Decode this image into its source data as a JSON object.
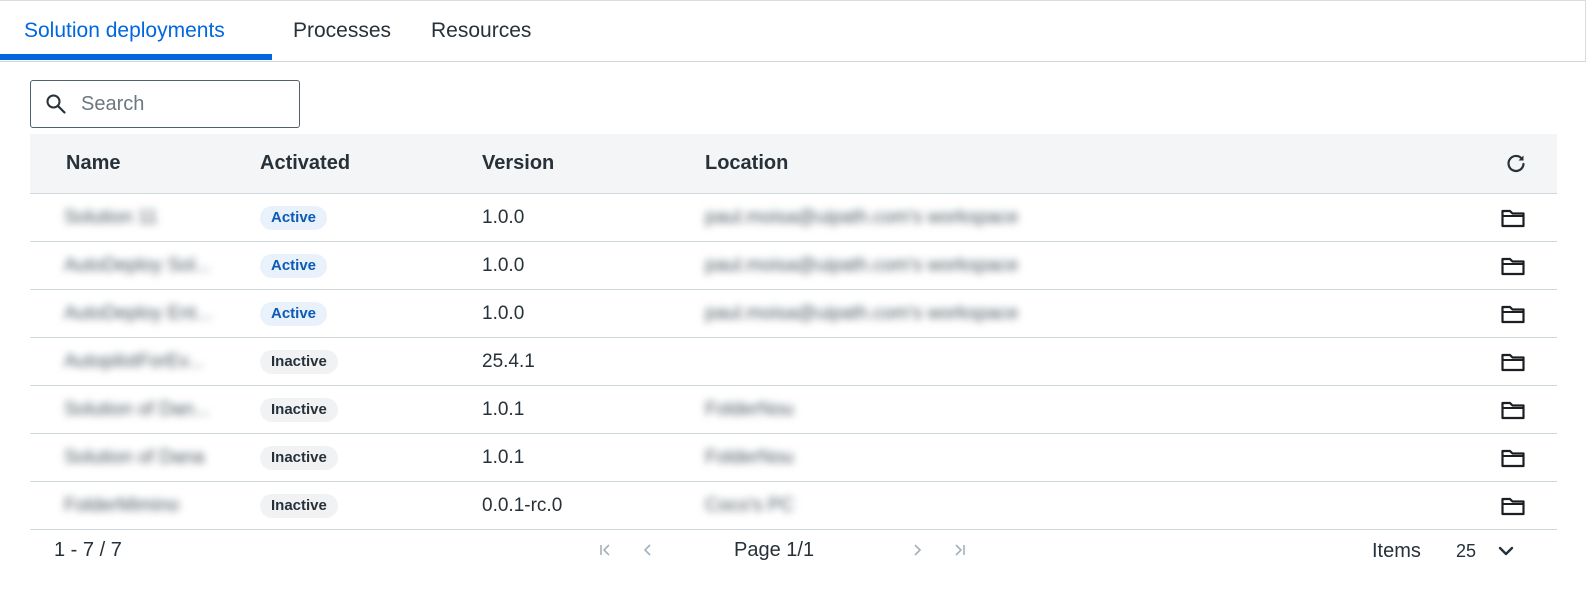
{
  "tabs": [
    {
      "label": "Solution deployments",
      "active": true
    },
    {
      "label": "Processes",
      "active": false
    },
    {
      "label": "Resources",
      "active": false
    }
  ],
  "search": {
    "placeholder": "Search",
    "value": "",
    "icon": "search-icon"
  },
  "table": {
    "columns": [
      "Name",
      "Activated",
      "Version",
      "Location"
    ],
    "refresh_icon": "refresh-icon",
    "rows": [
      {
        "name": "Solution 11",
        "status": "Active",
        "version": "1.0.0",
        "location": "paul.moisa@uipath.com's workspace"
      },
      {
        "name": "AutoDeploy Sol...",
        "status": "Active",
        "version": "1.0.0",
        "location": "paul.moisa@uipath.com's workspace"
      },
      {
        "name": "AutoDeploy Ent...",
        "status": "Active",
        "version": "1.0.0",
        "location": "paul.moisa@uipath.com's workspace"
      },
      {
        "name": "AutopilotForEv...",
        "status": "Inactive",
        "version": "25.4.1",
        "location": ""
      },
      {
        "name": "Solution of Dan...",
        "status": "Inactive",
        "version": "1.0.1",
        "location": "FolderNou"
      },
      {
        "name": "Solution of Dana",
        "status": "Inactive",
        "version": "1.0.1",
        "location": "FolderNou"
      },
      {
        "name": "FolderMimino",
        "status": "Inactive",
        "version": "0.0.1-rc.0",
        "location": "Coco's PC"
      }
    ],
    "row_action_icon": "folder-icon"
  },
  "footer": {
    "range": "1 - 7 / 7",
    "page": "Page 1/1",
    "items_label": "Items",
    "items_per_page": "25"
  },
  "colors": {
    "accent": "#0067df",
    "active_badge_bg": "#e9f1fa",
    "active_badge_text": "#0b5bb4",
    "inactive_badge_bg": "#f1f2f4",
    "header_bg": "#f4f5f7"
  }
}
